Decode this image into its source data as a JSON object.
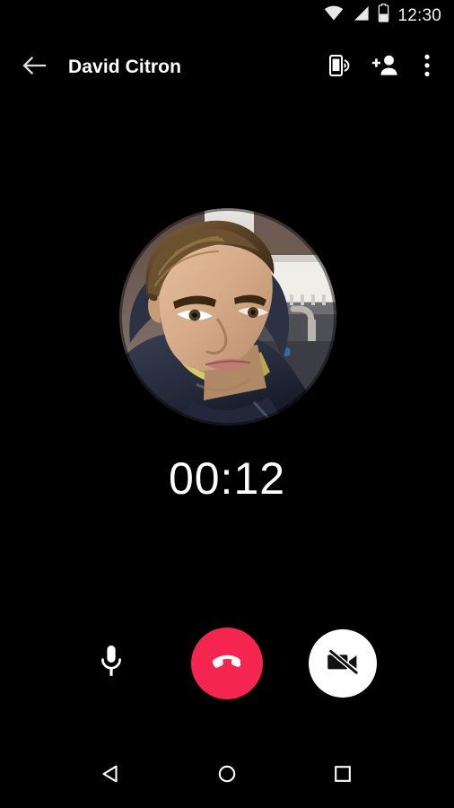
{
  "status_bar": {
    "time": "12:30",
    "icons": [
      "wifi-icon",
      "cellular-signal-icon",
      "battery-icon"
    ]
  },
  "app_bar": {
    "back_icon": "back-arrow-icon",
    "title": "David Citron",
    "actions": [
      {
        "name": "switch-to-phone-call-icon",
        "label": "Switch to phone call"
      },
      {
        "name": "add-person-icon",
        "label": "Add person"
      },
      {
        "name": "overflow-menu-icon",
        "label": "More options"
      }
    ]
  },
  "call": {
    "avatar_alt": "David Citron profile photo",
    "timer": "00:12"
  },
  "controls": {
    "mic": {
      "name": "microphone-icon",
      "label": "Mute microphone",
      "state": "unmuted"
    },
    "end_call": {
      "name": "end-call-icon",
      "label": "End call"
    },
    "camera": {
      "name": "camera-off-icon",
      "label": "Turn on camera",
      "state": "off"
    }
  },
  "nav_bar": {
    "back": "back-triangle-icon",
    "home": "home-circle-icon",
    "recents": "recents-square-icon"
  },
  "colors": {
    "background": "#000000",
    "end_call_red": "#f4254e",
    "camera_button_white": "#ffffff",
    "text_primary": "#ffffff",
    "status_icon": "#e8e8e8"
  }
}
